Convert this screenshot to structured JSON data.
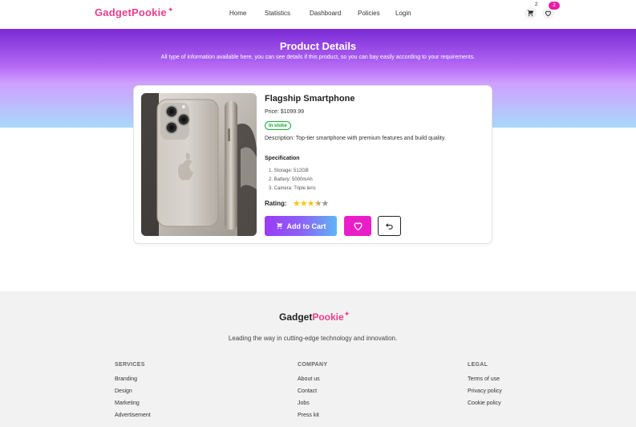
{
  "brand": {
    "part1": "Gadget",
    "part2": "Pookie",
    "spark": "✦"
  },
  "nav": {
    "home": "Home",
    "statistics": "Statistics",
    "dashboard": "Dashboard",
    "policies": "Policies",
    "login": "Login"
  },
  "header_icons": {
    "cart_icon": "cart-icon",
    "cart_count": "2",
    "wishlist_icon": "heart-icon",
    "wishlist_count": "2"
  },
  "hero": {
    "title": "Product Details",
    "subtitle": "All type of information available here, you can see details if this product, so you can bay easily according to your requirements."
  },
  "product": {
    "name": "Flagship Smartphone",
    "price": "Price: $1099.99",
    "stock": "In stoke",
    "description": "Description: Top-tier smartphone with premium features and build quality.",
    "spec_title": "Specification",
    "specs": [
      "1. Storage: 512GB",
      "2. Battery: 5000mAh",
      "3. Camera: Triple lens"
    ],
    "rating_label": "Rating:",
    "rating": 3.5,
    "rating_max": 5,
    "add_to_cart": "Add to Cart"
  },
  "colors": {
    "accent": "#9b3af5",
    "wishlist": "#e91ec9",
    "in_stock": "#28a745",
    "star": "#f5c518"
  },
  "footer": {
    "brand_a": "Gadget",
    "brand_b": "Pookie",
    "tagline": "Leading the way in cutting-edge technology and innovation.",
    "services": {
      "title": "SERVICES",
      "links": [
        "Branding",
        "Design",
        "Marketing",
        "Advertisement"
      ]
    },
    "company": {
      "title": "COMPANY",
      "links": [
        "About us",
        "Contact",
        "Jobs",
        "Press kit"
      ]
    },
    "legal": {
      "title": "LEGAL",
      "links": [
        "Terms of use",
        "Privacy policy",
        "Cookie policy"
      ]
    }
  }
}
